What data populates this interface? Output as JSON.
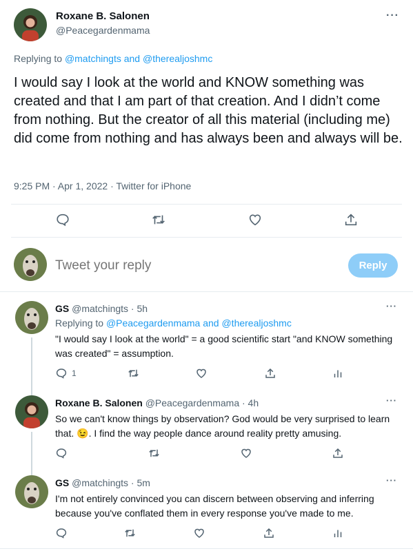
{
  "main": {
    "name": "Roxane B. Salonen",
    "handle": "@Peacegardenmama",
    "replying_prefix": "Replying to",
    "replying_targets": "@matchingts and @therealjoshmc",
    "body": "I would say I look at the world and KNOW something was created and that I am part of that creation. And I didn’t come from nothing. But the creator of all this material (including me) did come from nothing and has always been and always will be.",
    "meta": "9:25 PM · Apr 1, 2022 · Twitter for iPhone",
    "more": "···"
  },
  "composer": {
    "placeholder": "Tweet your reply",
    "button": "Reply"
  },
  "replies": [
    {
      "name": "GS",
      "handle_time": "@matchingts · 5h",
      "replying_prefix": "Replying to",
      "replying_targets": "@Peacegardenmama and @therealjoshmc",
      "body": "\"I would say I look at the world\" = a good scientific start \"and KNOW something was created\" = assumption.",
      "reply_count": "1",
      "more": "···"
    },
    {
      "name": "Roxane B. Salonen",
      "handle_time": "@Peacegardenmama · 4h",
      "body_a": "So we can't know things by observation? God would be very surprised to learn that.",
      "emoji": "😉",
      "body_b": ". I find the way people dance around reality pretty amusing.",
      "more": "···"
    },
    {
      "name": "GS",
      "handle_time": "@matchingts · 5m",
      "body": "I'm not entirely convinced you can discern between observing and inferring because you've conflated them in every response you've made to me.",
      "more": "···"
    }
  ],
  "colors": {
    "accent": "#1d9bf0",
    "reply_button": "#8ecdf8",
    "muted": "#536471",
    "divider": "#e6ecf0"
  }
}
